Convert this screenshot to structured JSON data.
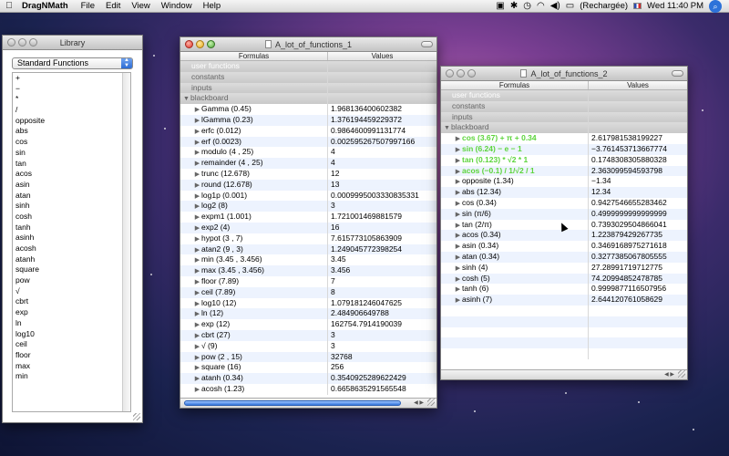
{
  "menubar": {
    "app_name": "DragNMath",
    "menus": [
      "File",
      "Edit",
      "View",
      "Window",
      "Help"
    ],
    "battery_text": "(Rechargée)",
    "clock": "Wed 11:40 PM"
  },
  "library": {
    "title": "Library",
    "selected": "Standard Functions",
    "items": [
      "+",
      "−",
      "*",
      "/",
      "opposite",
      "abs",
      "cos",
      "sin",
      "tan",
      "acos",
      "asin",
      "atan",
      "sinh",
      "cosh",
      "tanh",
      "asinh",
      "acosh",
      "atanh",
      "square",
      "pow",
      "√",
      "cbrt",
      "exp",
      "ln",
      "log10",
      "ceil",
      "floor",
      "max",
      "min"
    ]
  },
  "window1": {
    "title": "A_lot_of_functions_1",
    "col_formulas": "Formulas",
    "col_values": "Values",
    "groups": {
      "user": "user functions",
      "constants": "constants",
      "inputs": "inputs",
      "blackboard": "blackboard"
    },
    "rows": [
      {
        "f": "Gamma (0.45)",
        "v": "1.968136400602382"
      },
      {
        "f": "lGamma (0.23)",
        "v": "1.376194459229372"
      },
      {
        "f": "erfc (0.012)",
        "v": "0.9864600991131774"
      },
      {
        "f": "erf (0.0023)",
        "v": "0.002595267507997166"
      },
      {
        "f": "modulo (4 , 25)",
        "v": "4"
      },
      {
        "f": "remainder (4 , 25)",
        "v": "4"
      },
      {
        "f": "trunc (12.678)",
        "v": "12"
      },
      {
        "f": "round (12.678)",
        "v": "13"
      },
      {
        "f": "log1p (0.001)",
        "v": "0.0009995003330835331"
      },
      {
        "f": "log2 (8)",
        "v": "3"
      },
      {
        "f": "expm1 (1.001)",
        "v": "1.721001469881579"
      },
      {
        "f": "exp2 (4)",
        "v": "16"
      },
      {
        "f": "hypot (3 , 7)",
        "v": "7.615773105863909"
      },
      {
        "f": "atan2 (9 , 3)",
        "v": "1.249045772398254"
      },
      {
        "f": "min (3.45 , 3.456)",
        "v": "3.45"
      },
      {
        "f": "max (3.45 , 3.456)",
        "v": "3.456"
      },
      {
        "f": "floor (7.89)",
        "v": "7"
      },
      {
        "f": "ceil (7.89)",
        "v": "8"
      },
      {
        "f": "log10 (12)",
        "v": "1.079181246047625"
      },
      {
        "f": "ln (12)",
        "v": "2.484906649788"
      },
      {
        "f": "exp (12)",
        "v": "162754.7914190039"
      },
      {
        "f": "cbrt (27)",
        "v": "3"
      },
      {
        "f": "√ (9)",
        "v": "3"
      },
      {
        "f": "pow (2 , 15)",
        "v": "32768"
      },
      {
        "f": "square (16)",
        "v": "256"
      },
      {
        "f": "atanh (0.34)",
        "v": "0.3540925289622429"
      },
      {
        "f": "acosh (1.23)",
        "v": "0.6658635291565548"
      }
    ]
  },
  "window2": {
    "title": "A_lot_of_functions_2",
    "col_formulas": "Formulas",
    "col_values": "Values",
    "groups": {
      "user": "user functions",
      "constants": "constants",
      "inputs": "inputs",
      "blackboard": "blackboard"
    },
    "rows": [
      {
        "f": "cos (3.67) + π + 0.34",
        "v": "2.617981538199227",
        "hl": true
      },
      {
        "f": "sin (6.24) − e − 1",
        "v": "−3.761453713667774",
        "hl": true
      },
      {
        "f": "tan (0.123) * √2 * 1",
        "v": "0.1748308305880328",
        "hl": true
      },
      {
        "f": "acos (−0.1) / 1/√2 / 1",
        "v": "2.363099594593798",
        "hl": true
      },
      {
        "f": "opposite (1.34)",
        "v": "−1.34"
      },
      {
        "f": "abs (12.34)",
        "v": "12.34"
      },
      {
        "f": "cos (0.34)",
        "v": "0.9427546655283462"
      },
      {
        "f": "sin (π/6)",
        "v": "0.4999999999999999"
      },
      {
        "f": "tan (2/π)",
        "v": "0.7393029504866041"
      },
      {
        "f": "acos (0.34)",
        "v": "1.223879429267735"
      },
      {
        "f": "asin (0.34)",
        "v": "0.3469168975271618"
      },
      {
        "f": "atan (0.34)",
        "v": "0.3277385067805555"
      },
      {
        "f": "sinh (4)",
        "v": "27.28991719712775"
      },
      {
        "f": "cosh (5)",
        "v": "74.20994852478785"
      },
      {
        "f": "tanh (6)",
        "v": "0.9999877116507956"
      },
      {
        "f": "asinh (7)",
        "v": "2.644120761058629"
      }
    ]
  }
}
